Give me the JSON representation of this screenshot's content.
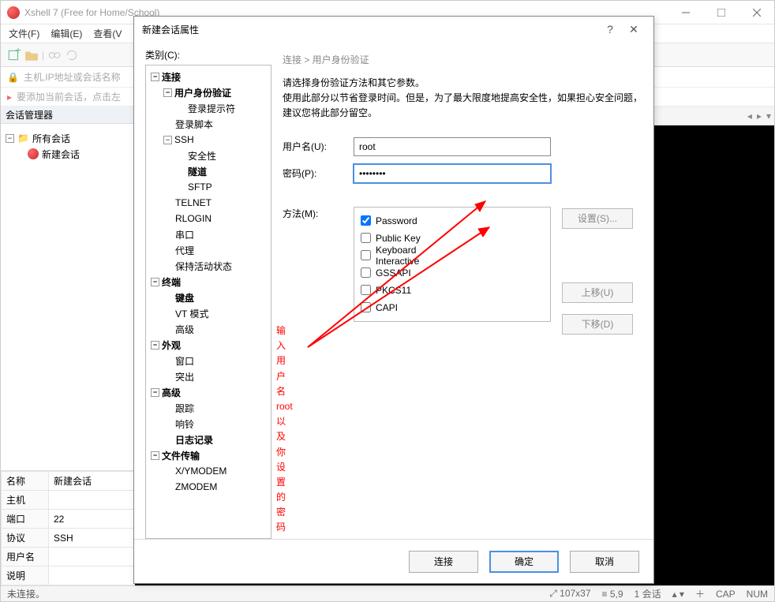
{
  "window": {
    "title": "Xshell 7 (Free for Home/School)"
  },
  "menubar": [
    "文件(F)",
    "编辑(E)",
    "查看(V"
  ],
  "addressbar": {
    "placeholder": "主机,IP地址或会话名称"
  },
  "tipbar": {
    "text": "要添加当前会话，点击左"
  },
  "session_manager": {
    "header": "会话管理器",
    "root": "所有会话",
    "items": [
      "新建会话"
    ]
  },
  "properties": {
    "rows": [
      {
        "label": "名称",
        "value": "新建会话"
      },
      {
        "label": "主机",
        "value": ""
      },
      {
        "label": "端口",
        "value": "22"
      },
      {
        "label": "协议",
        "value": "SSH"
      },
      {
        "label": "用户名",
        "value": ""
      },
      {
        "label": "说明",
        "value": ""
      }
    ]
  },
  "statusbar": {
    "left": "未连接。",
    "size": "107x37",
    "pos": "5,9",
    "sess": "1 会话",
    "cap": "CAP",
    "num": "NUM"
  },
  "dialog": {
    "title": "新建会话属性",
    "category_label": "类别(C):",
    "categories": [
      {
        "label": "连接",
        "level": 1,
        "bold": true,
        "exp": "-"
      },
      {
        "label": "用户身份验证",
        "level": 2,
        "bold": true,
        "exp": "-"
      },
      {
        "label": "登录提示符",
        "level": 3,
        "bold": false
      },
      {
        "label": "登录脚本",
        "level": 2,
        "bold": false
      },
      {
        "label": "SSH",
        "level": 2,
        "bold": false,
        "exp": "-"
      },
      {
        "label": "安全性",
        "level": 3,
        "bold": false
      },
      {
        "label": "隧道",
        "level": 3,
        "bold": true
      },
      {
        "label": "SFTP",
        "level": 3,
        "bold": false
      },
      {
        "label": "TELNET",
        "level": 2,
        "bold": false
      },
      {
        "label": "RLOGIN",
        "level": 2,
        "bold": false
      },
      {
        "label": "串口",
        "level": 2,
        "bold": false
      },
      {
        "label": "代理",
        "level": 2,
        "bold": false
      },
      {
        "label": "保持活动状态",
        "level": 2,
        "bold": false
      },
      {
        "label": "终端",
        "level": 1,
        "bold": true,
        "exp": "-"
      },
      {
        "label": "键盘",
        "level": 2,
        "bold": true
      },
      {
        "label": "VT 模式",
        "level": 2,
        "bold": false
      },
      {
        "label": "高级",
        "level": 2,
        "bold": false
      },
      {
        "label": "外观",
        "level": 1,
        "bold": true,
        "exp": "-"
      },
      {
        "label": "窗口",
        "level": 2,
        "bold": false
      },
      {
        "label": "突出",
        "level": 2,
        "bold": false
      },
      {
        "label": "高级",
        "level": 1,
        "bold": true,
        "exp": "-"
      },
      {
        "label": "跟踪",
        "level": 2,
        "bold": false
      },
      {
        "label": "响铃",
        "level": 2,
        "bold": false
      },
      {
        "label": "日志记录",
        "level": 2,
        "bold": true
      },
      {
        "label": "文件传输",
        "level": 1,
        "bold": true,
        "exp": "-"
      },
      {
        "label": "X/YMODEM",
        "level": 2,
        "bold": false
      },
      {
        "label": "ZMODEM",
        "level": 2,
        "bold": false
      }
    ],
    "breadcrumb": "连接  >  用户身份验证",
    "desc1": "请选择身份验证方法和其它参数。",
    "desc2": "使用此部分以节省登录时间。但是，为了最大限度地提高安全性，如果担心安全问题，建议您将此部分留空。",
    "username_label": "用户名(U):",
    "username_value": "root",
    "password_label": "密码(P):",
    "password_value": "••••••••",
    "method_label": "方法(M):",
    "methods": [
      {
        "label": "Password",
        "checked": true
      },
      {
        "label": "Public Key",
        "checked": false
      },
      {
        "label": "Keyboard Interactive",
        "checked": false
      },
      {
        "label": "GSSAPI",
        "checked": false
      },
      {
        "label": "PKCS11",
        "checked": false
      },
      {
        "label": "CAPI",
        "checked": false
      }
    ],
    "btn_settings": "设置(S)...",
    "btn_up": "上移(U)",
    "btn_down": "下移(D)",
    "btn_connect": "连接",
    "btn_ok": "确定",
    "btn_cancel": "取消"
  },
  "annotation": {
    "line1": "输入用户名",
    "line2": "root",
    "line3": "以及你设置的密码"
  }
}
